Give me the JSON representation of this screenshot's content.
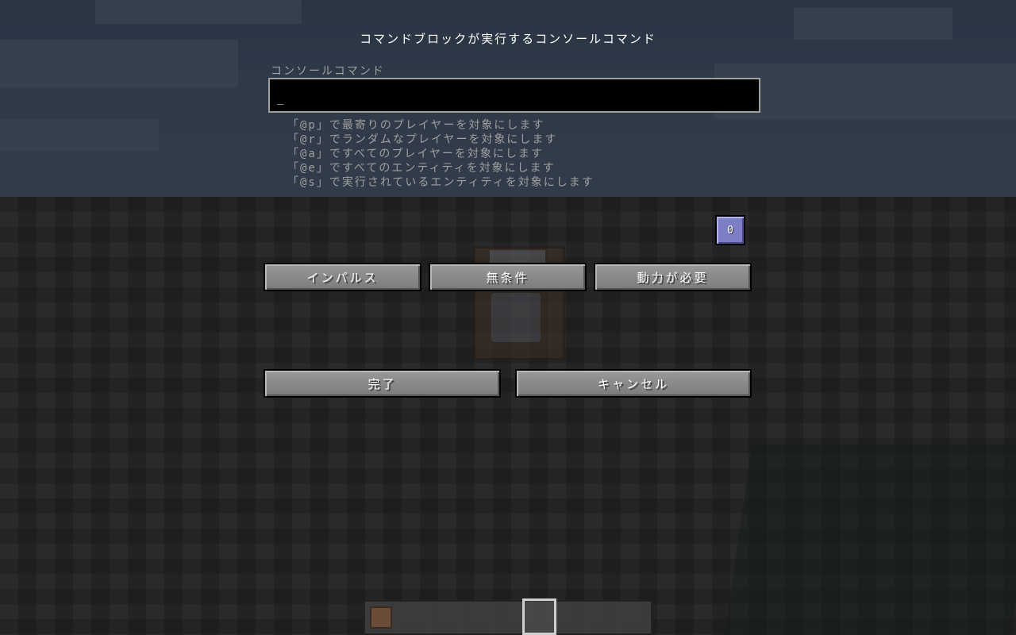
{
  "screen": {
    "title": "コマンドブロックが実行するコンソールコマンド",
    "command_label": "コンソールコマンド",
    "command_value": "",
    "caret": "_"
  },
  "hints": [
    "「@p」で最寄りのプレイヤーを対象にします",
    "「@r」でランダムなプレイヤーを対象にします",
    "「@a」ですべてのプレイヤーを対象にします",
    "「@e」ですべてのエンティティを対象にします",
    "「@s」で実行されているエンティティを対象にします"
  ],
  "success_count": "0",
  "mode_buttons": {
    "type": "インパルス",
    "condition": "無条件",
    "redstone": "動力が必要"
  },
  "actions": {
    "done": "完了",
    "cancel": "キャンセル"
  },
  "hotbar": {
    "slot_count": 9,
    "selected_index": 5,
    "items": [
      "command-block-icon"
    ]
  },
  "colors": {
    "success_count_button": "#7c7fc6",
    "button_gray": "#8a8a8a"
  }
}
